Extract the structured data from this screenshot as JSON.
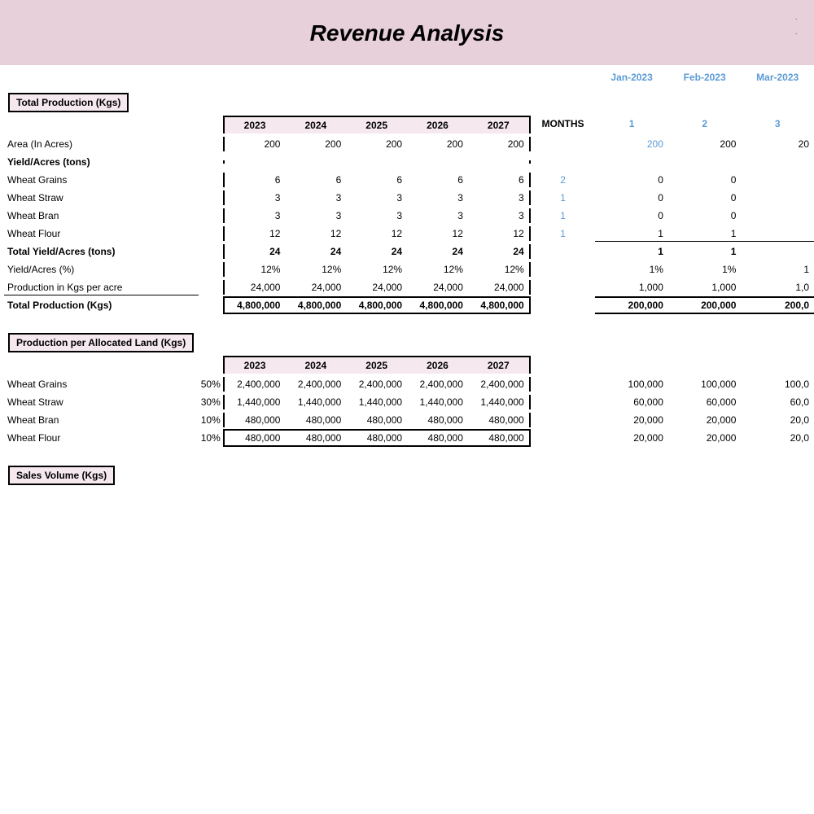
{
  "header": {
    "title": "Revenue Analysis",
    "bg_color": "#e8d0da"
  },
  "columns": {
    "years": [
      "2023",
      "2024",
      "2025",
      "2026",
      "2027"
    ],
    "months_label": "MONTHS",
    "month_numbers": [
      "1",
      "2",
      "3"
    ],
    "month_names": [
      "Jan-2023",
      "Feb-2023",
      "Mar-2023"
    ]
  },
  "section1": {
    "header": "Total Production (Kgs)",
    "rows": [
      {
        "label": "Area (In Acres)",
        "bold": false,
        "pct": "",
        "years_data": [
          "200",
          "200",
          "200",
          "200",
          "200"
        ],
        "months_label_val": "",
        "months_data": [
          "200",
          "200",
          "20"
        ],
        "months_blue": [
          true,
          false,
          false
        ]
      },
      {
        "label": "Yield/Acres (tons)",
        "bold": true,
        "pct": "",
        "years_data": [
          "",
          "",
          "",
          "",
          ""
        ],
        "months_label_val": "",
        "months_data": [
          "",
          "",
          ""
        ],
        "months_blue": [
          false,
          false,
          false
        ]
      },
      {
        "label": "Wheat Grains",
        "bold": false,
        "pct": "",
        "years_data": [
          "6",
          "6",
          "6",
          "6",
          "6"
        ],
        "months_label_val": "2",
        "months_label_blue": true,
        "months_data": [
          "0",
          "0",
          ""
        ],
        "months_blue": [
          false,
          false,
          false
        ]
      },
      {
        "label": "Wheat Straw",
        "bold": false,
        "pct": "",
        "years_data": [
          "3",
          "3",
          "3",
          "3",
          "3"
        ],
        "months_label_val": "1",
        "months_label_blue": true,
        "months_data": [
          "0",
          "0",
          ""
        ],
        "months_blue": [
          false,
          false,
          false
        ]
      },
      {
        "label": "Wheat Bran",
        "bold": false,
        "pct": "",
        "years_data": [
          "3",
          "3",
          "3",
          "3",
          "3"
        ],
        "months_label_val": "1",
        "months_label_blue": true,
        "months_data": [
          "0",
          "0",
          ""
        ],
        "months_blue": [
          false,
          false,
          false
        ]
      },
      {
        "label": "Wheat Flour",
        "bold": false,
        "pct": "",
        "years_data": [
          "12",
          "12",
          "12",
          "12",
          "12"
        ],
        "months_label_val": "1",
        "months_label_blue": true,
        "months_data": [
          "1",
          "1",
          ""
        ],
        "months_blue": [
          false,
          false,
          false
        ],
        "bottom_border": true
      },
      {
        "label": "Total Yield/Acres (tons)",
        "bold": true,
        "pct": "",
        "years_data": [
          "24",
          "24",
          "24",
          "24",
          "24"
        ],
        "months_label_val": "",
        "months_data": [
          "1",
          "1",
          ""
        ],
        "months_blue": [
          false,
          false,
          false
        ]
      },
      {
        "label": "Yield/Acres (%)",
        "bold": false,
        "pct": "",
        "years_data": [
          "12%",
          "12%",
          "12%",
          "12%",
          "12%"
        ],
        "months_label_val": "",
        "months_data": [
          "1%",
          "1%",
          "1"
        ],
        "months_blue": [
          false,
          false,
          false
        ]
      },
      {
        "label": "Production in Kgs per acre",
        "bold": false,
        "pct": "",
        "years_data": [
          "24,000",
          "24,000",
          "24,000",
          "24,000",
          "24,000"
        ],
        "months_label_val": "",
        "months_data": [
          "1,000",
          "1,000",
          "1,0"
        ],
        "months_blue": [
          false,
          false,
          false
        ],
        "bottom_border_label": true
      },
      {
        "label": "Total Production (Kgs)",
        "bold": true,
        "pct": "",
        "years_data": [
          "4,800,000",
          "4,800,000",
          "4,800,000",
          "4,800,000",
          "4,800,000"
        ],
        "months_label_val": "",
        "months_data": [
          "200,000",
          "200,000",
          "200,0"
        ],
        "months_blue": [
          false,
          false,
          false
        ],
        "years_thick_border": true,
        "months_thick_border": true
      }
    ]
  },
  "section2": {
    "header": "Production per Allocated Land (Kgs)",
    "rows": [
      {
        "label": "Wheat Grains",
        "bold": false,
        "pct": "50%",
        "years_data": [
          "2,400,000",
          "2,400,000",
          "2,400,000",
          "2,400,000",
          "2,400,000"
        ],
        "months_label_val": "",
        "months_data": [
          "100,000",
          "100,000",
          "100,0"
        ],
        "months_blue": [
          false,
          false,
          false
        ]
      },
      {
        "label": "Wheat Straw",
        "bold": false,
        "pct": "30%",
        "years_data": [
          "1,440,000",
          "1,440,000",
          "1,440,000",
          "1,440,000",
          "1,440,000"
        ],
        "months_label_val": "",
        "months_data": [
          "60,000",
          "60,000",
          "60,0"
        ],
        "months_blue": [
          false,
          false,
          false
        ]
      },
      {
        "label": "Wheat Bran",
        "bold": false,
        "pct": "10%",
        "years_data": [
          "480,000",
          "480,000",
          "480,000",
          "480,000",
          "480,000"
        ],
        "months_label_val": "",
        "months_data": [
          "20,000",
          "20,000",
          "20,0"
        ],
        "months_blue": [
          false,
          false,
          false
        ]
      },
      {
        "label": "Wheat Flour",
        "bold": false,
        "pct": "10%",
        "years_data": [
          "480,000",
          "480,000",
          "480,000",
          "480,000",
          "480,000"
        ],
        "months_label_val": "",
        "months_data": [
          "20,000",
          "20,000",
          "20,0"
        ],
        "months_blue": [
          false,
          false,
          false
        ],
        "years_thick_border": true
      }
    ]
  },
  "section3": {
    "header": "Sales Volume (Kgs)"
  }
}
